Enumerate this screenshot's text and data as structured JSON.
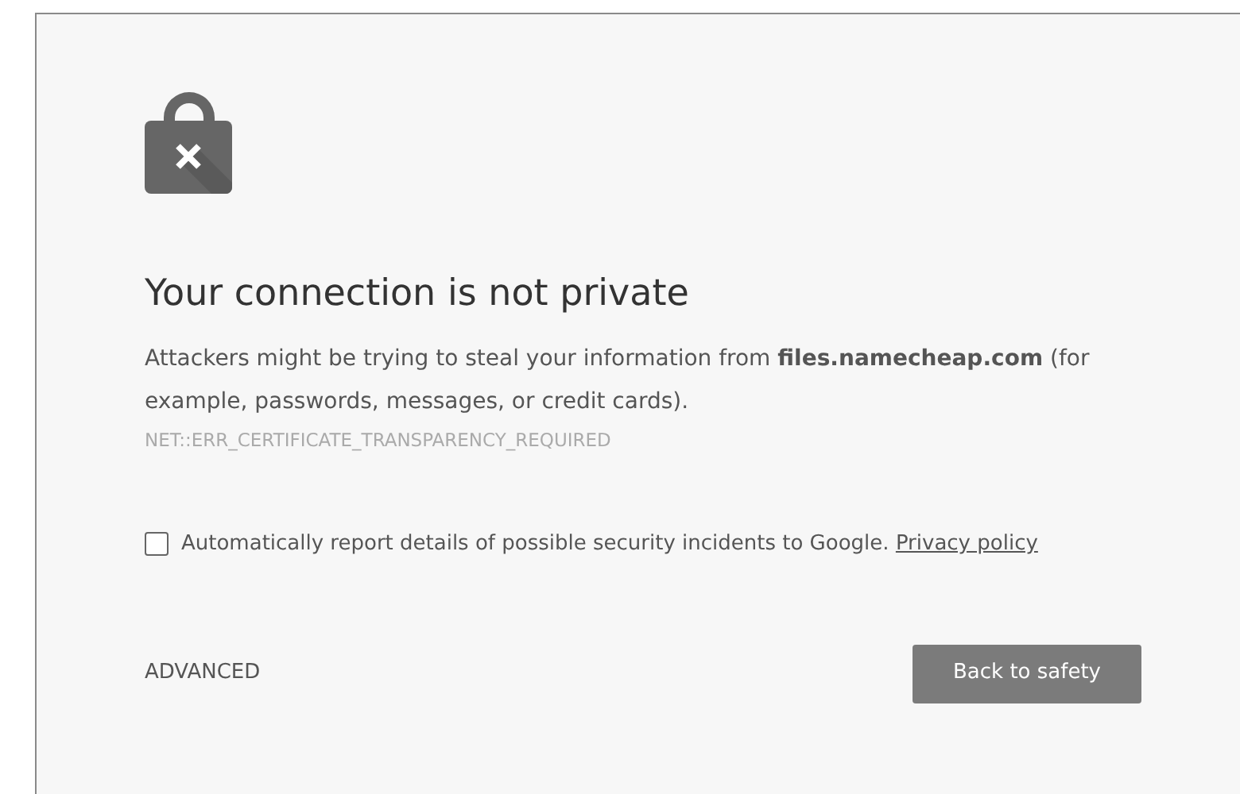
{
  "heading": "Your connection is not private",
  "message": "Attackers might be trying to steal your information from **files.namecheap.com** (for example, passwords, messages, or credit cards).",
  "error_code": "NET::ERR_CERTIFICATE_TRANSPARENCY_REQUIRED",
  "report": {
    "label": "Automatically report details of possible security incidents to Google.",
    "link": "Privacy policy",
    "checked": false
  },
  "advanced_link": "ADVANCED",
  "primary_button": "Back to safety"
}
